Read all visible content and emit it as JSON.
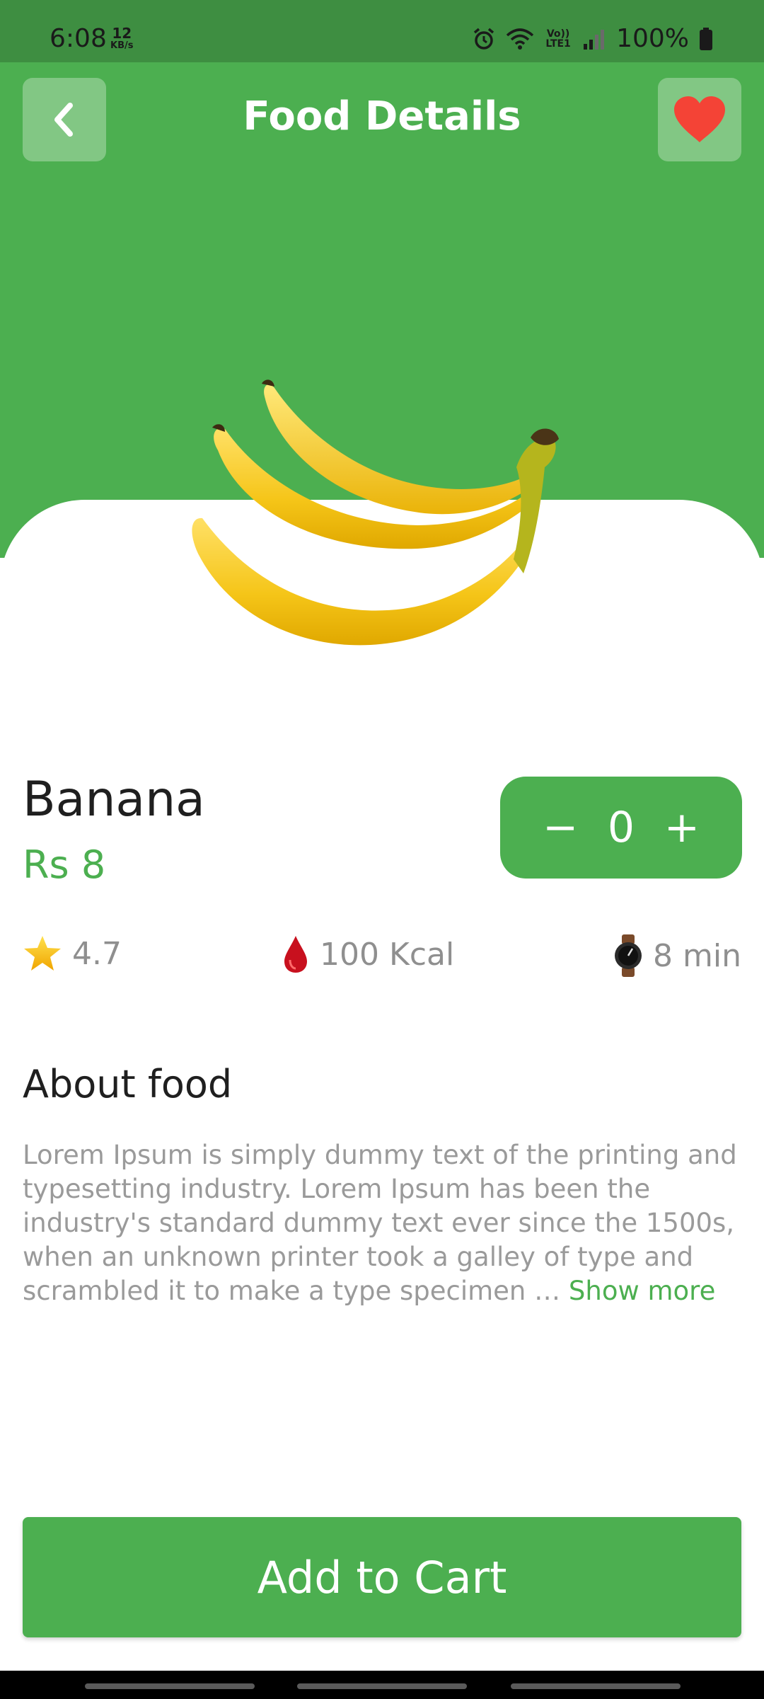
{
  "status_bar": {
    "time": "6:08",
    "net_speed_value": "12",
    "net_speed_unit": "KB/s",
    "network_label": "Vo)) LTE1",
    "battery": "100%"
  },
  "header": {
    "title": "Food Details"
  },
  "food": {
    "name": "Banana",
    "price": "Rs 8",
    "quantity": "0",
    "decrement_label": "−",
    "increment_label": "+"
  },
  "stats": {
    "rating": "4.7",
    "calories": "100 Kcal",
    "time": "8 min"
  },
  "about": {
    "title": "About food",
    "text": "Lorem Ipsum is simply dummy text of the printing and typesetting industry. Lorem Ipsum has been the industry's standard dummy text ever since the 1500s, when an unknown printer took a galley of type and scrambled it to make a type specimen … ",
    "show_more": "Show more"
  },
  "cart": {
    "button_label": "Add to Cart"
  },
  "colors": {
    "accent": "#4caf50",
    "status_bar": "#3e8e41",
    "favorite": "#f44336"
  },
  "icons": {
    "back": "chevron-left-icon",
    "favorite": "heart-icon",
    "rating": "star-icon",
    "calories": "drop-icon",
    "time": "watch-icon"
  }
}
